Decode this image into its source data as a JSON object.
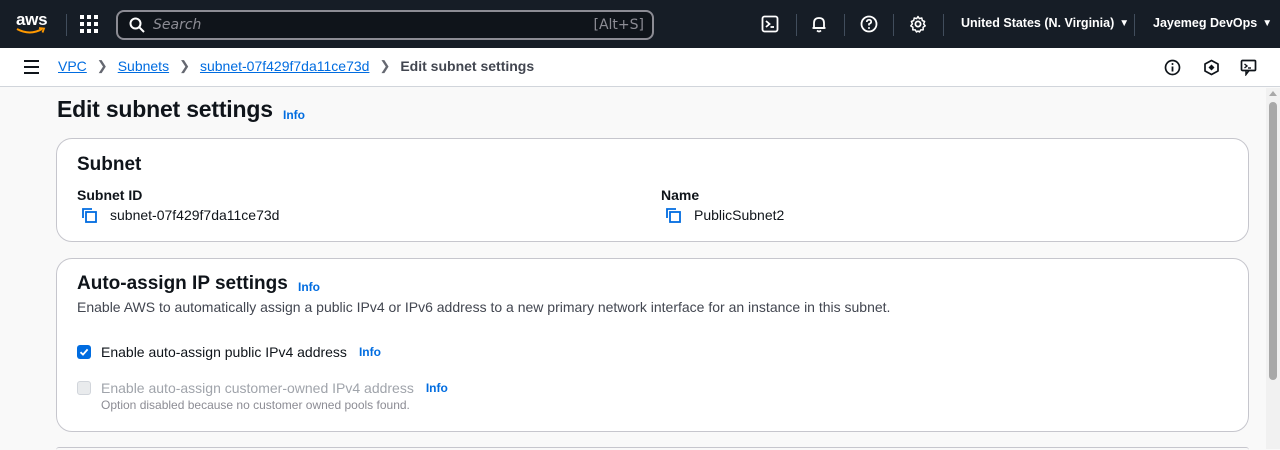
{
  "topnav": {
    "logo_text": "aws",
    "search_placeholder": "Search",
    "search_shortcut": "[Alt+S]",
    "region": "United States (N. Virginia)",
    "account": "Jayemeg DevOps"
  },
  "breadcrumb": {
    "items": [
      "VPC",
      "Subnets",
      "subnet-07f429f7da11ce73d"
    ],
    "current": "Edit subnet settings"
  },
  "page": {
    "title": "Edit subnet settings",
    "info": "Info"
  },
  "subnet_card": {
    "title": "Subnet",
    "subnet_id_label": "Subnet ID",
    "subnet_id_value": "subnet-07f429f7da11ce73d",
    "name_label": "Name",
    "name_value": "PublicSubnet2"
  },
  "auto_assign_card": {
    "title": "Auto-assign IP settings",
    "info": "Info",
    "description": "Enable AWS to automatically assign a public IPv4 or IPv6 address to a new primary network interface for an instance in this subnet.",
    "option_public_ipv4": {
      "label": "Enable auto-assign public IPv4 address",
      "info": "Info",
      "checked": true
    },
    "option_customer_owned": {
      "label": "Enable auto-assign customer-owned IPv4 address",
      "info": "Info",
      "checked": false,
      "disabled": true,
      "help": "Option disabled because no customer owned pools found."
    }
  },
  "colors": {
    "nav_bg": "#161d26",
    "link": "#006ce0",
    "card_border": "#c6c6cd",
    "page_bg": "#f9f9f9"
  },
  "icons": [
    "aws-logo",
    "apps-grid-icon",
    "search-icon",
    "cloudshell-icon",
    "bell-icon",
    "help-icon",
    "gear-icon",
    "menu-icon",
    "info-circle-icon",
    "feedback-icon",
    "notifications-panel-icon",
    "copy-icon",
    "checkmark-icon"
  ]
}
